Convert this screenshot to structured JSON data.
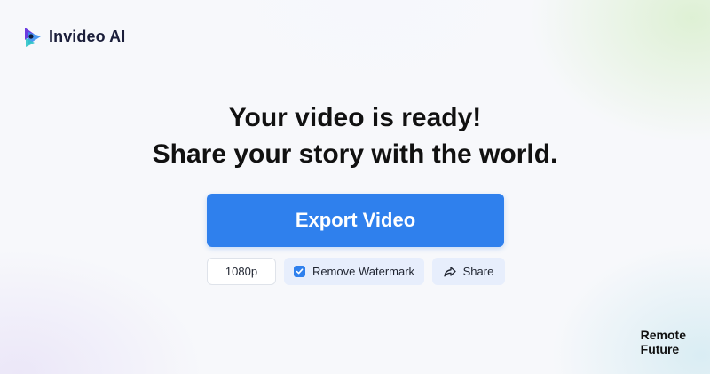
{
  "logo": {
    "text": "Invideo AI",
    "colors": [
      "#6a3ce0",
      "#3a8ef0",
      "#2ec4c8"
    ]
  },
  "headline": {
    "line1": "Your video is ready!",
    "line2": "Share your story with the world."
  },
  "export": {
    "label": "Export Video",
    "color": "#2f80ed"
  },
  "options": {
    "resolution": "1080p",
    "remove_watermark": {
      "label": "Remove Watermark",
      "checked": true,
      "icon": "checkbox-checked-icon"
    },
    "share": {
      "label": "Share",
      "icon": "share-arrow-icon"
    }
  },
  "watermark_brand": {
    "line1": "Remote",
    "line2": "Future"
  }
}
